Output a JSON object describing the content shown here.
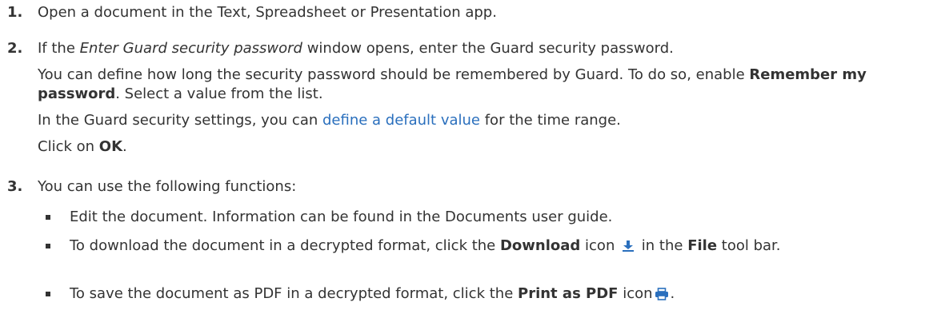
{
  "steps": [
    {
      "number": "1.",
      "text": "Open a document in the Text, Spreadsheet or Presentation app."
    },
    {
      "number": "2.",
      "line1_pre": "If the ",
      "line1_em": "Enter Guard security password",
      "line1_post": " window opens, enter the Guard security password.",
      "p2_pre": "You can define how long the security password should be remembered by Guard. To do so, enable ",
      "p2_bold": "Remember my password",
      "p2_post": ". Select a value from the list.",
      "p3_pre": "In the Guard security settings, you can ",
      "p3_link": "define a default value",
      "p3_post": " for the time range.",
      "p4_pre": "Click on ",
      "p4_bold": "OK",
      "p4_post": "."
    },
    {
      "number": "3.",
      "intro": "You can use the following functions:",
      "bullets": [
        {
          "text": "Edit the document. Information can be found in the Documents user guide."
        },
        {
          "pre": "To download the document in a decrypted format, click the ",
          "bold1": "Download",
          "mid": " icon ",
          "icon": "download-icon",
          "mid2": " in the ",
          "bold2": "File",
          "post": " tool bar."
        },
        {
          "pre": "To save the document as PDF in a decrypted format, click the ",
          "bold1": "Print as PDF",
          "mid": " icon",
          "icon": "print-icon",
          "post": "."
        }
      ]
    }
  ],
  "colors": {
    "text": "#333333",
    "link": "#2a6fbd",
    "icon": "#2a6fbd"
  }
}
